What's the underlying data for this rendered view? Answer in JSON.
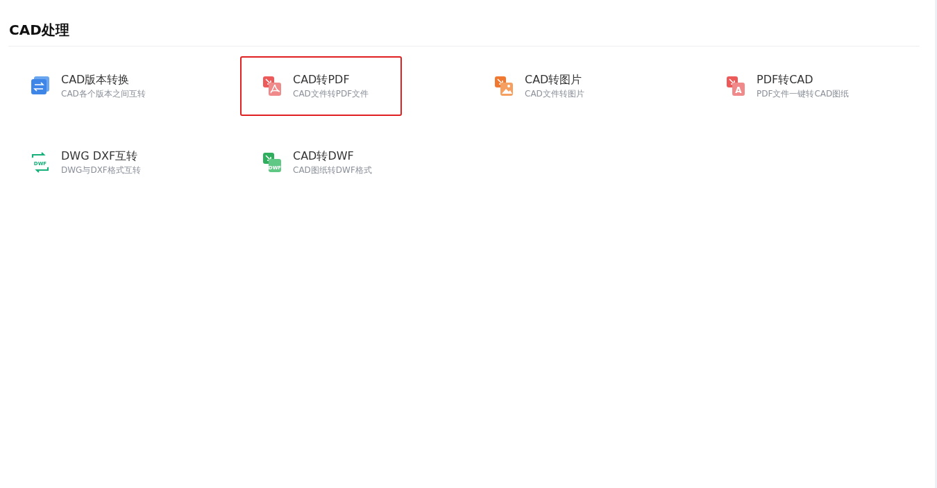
{
  "section": {
    "title": "CAD处理"
  },
  "tools": [
    {
      "name": "CAD版本转换",
      "description": "CAD各个版本之间互转",
      "kind": "convert",
      "selected": false
    },
    {
      "name": "CAD转PDF",
      "description": "CAD文件转PDF文件",
      "kind": "pdf",
      "selected": true
    },
    {
      "name": "CAD转图片",
      "description": "CAD文件转图片",
      "kind": "image",
      "selected": false
    },
    {
      "name": "PDF转CAD",
      "description": "PDF文件一键转CAD图纸",
      "kind": "letter",
      "icon_text": "A",
      "selected": false
    },
    {
      "name": "DWG DXF互转",
      "description": "DWG与DXF格式互转",
      "kind": "cycle",
      "icon_text": "DWF",
      "selected": false
    },
    {
      "name": "CAD转DWF",
      "description": "CAD图纸转DWF格式",
      "kind": "dwf",
      "icon_text": "DWF",
      "selected": false
    }
  ]
}
